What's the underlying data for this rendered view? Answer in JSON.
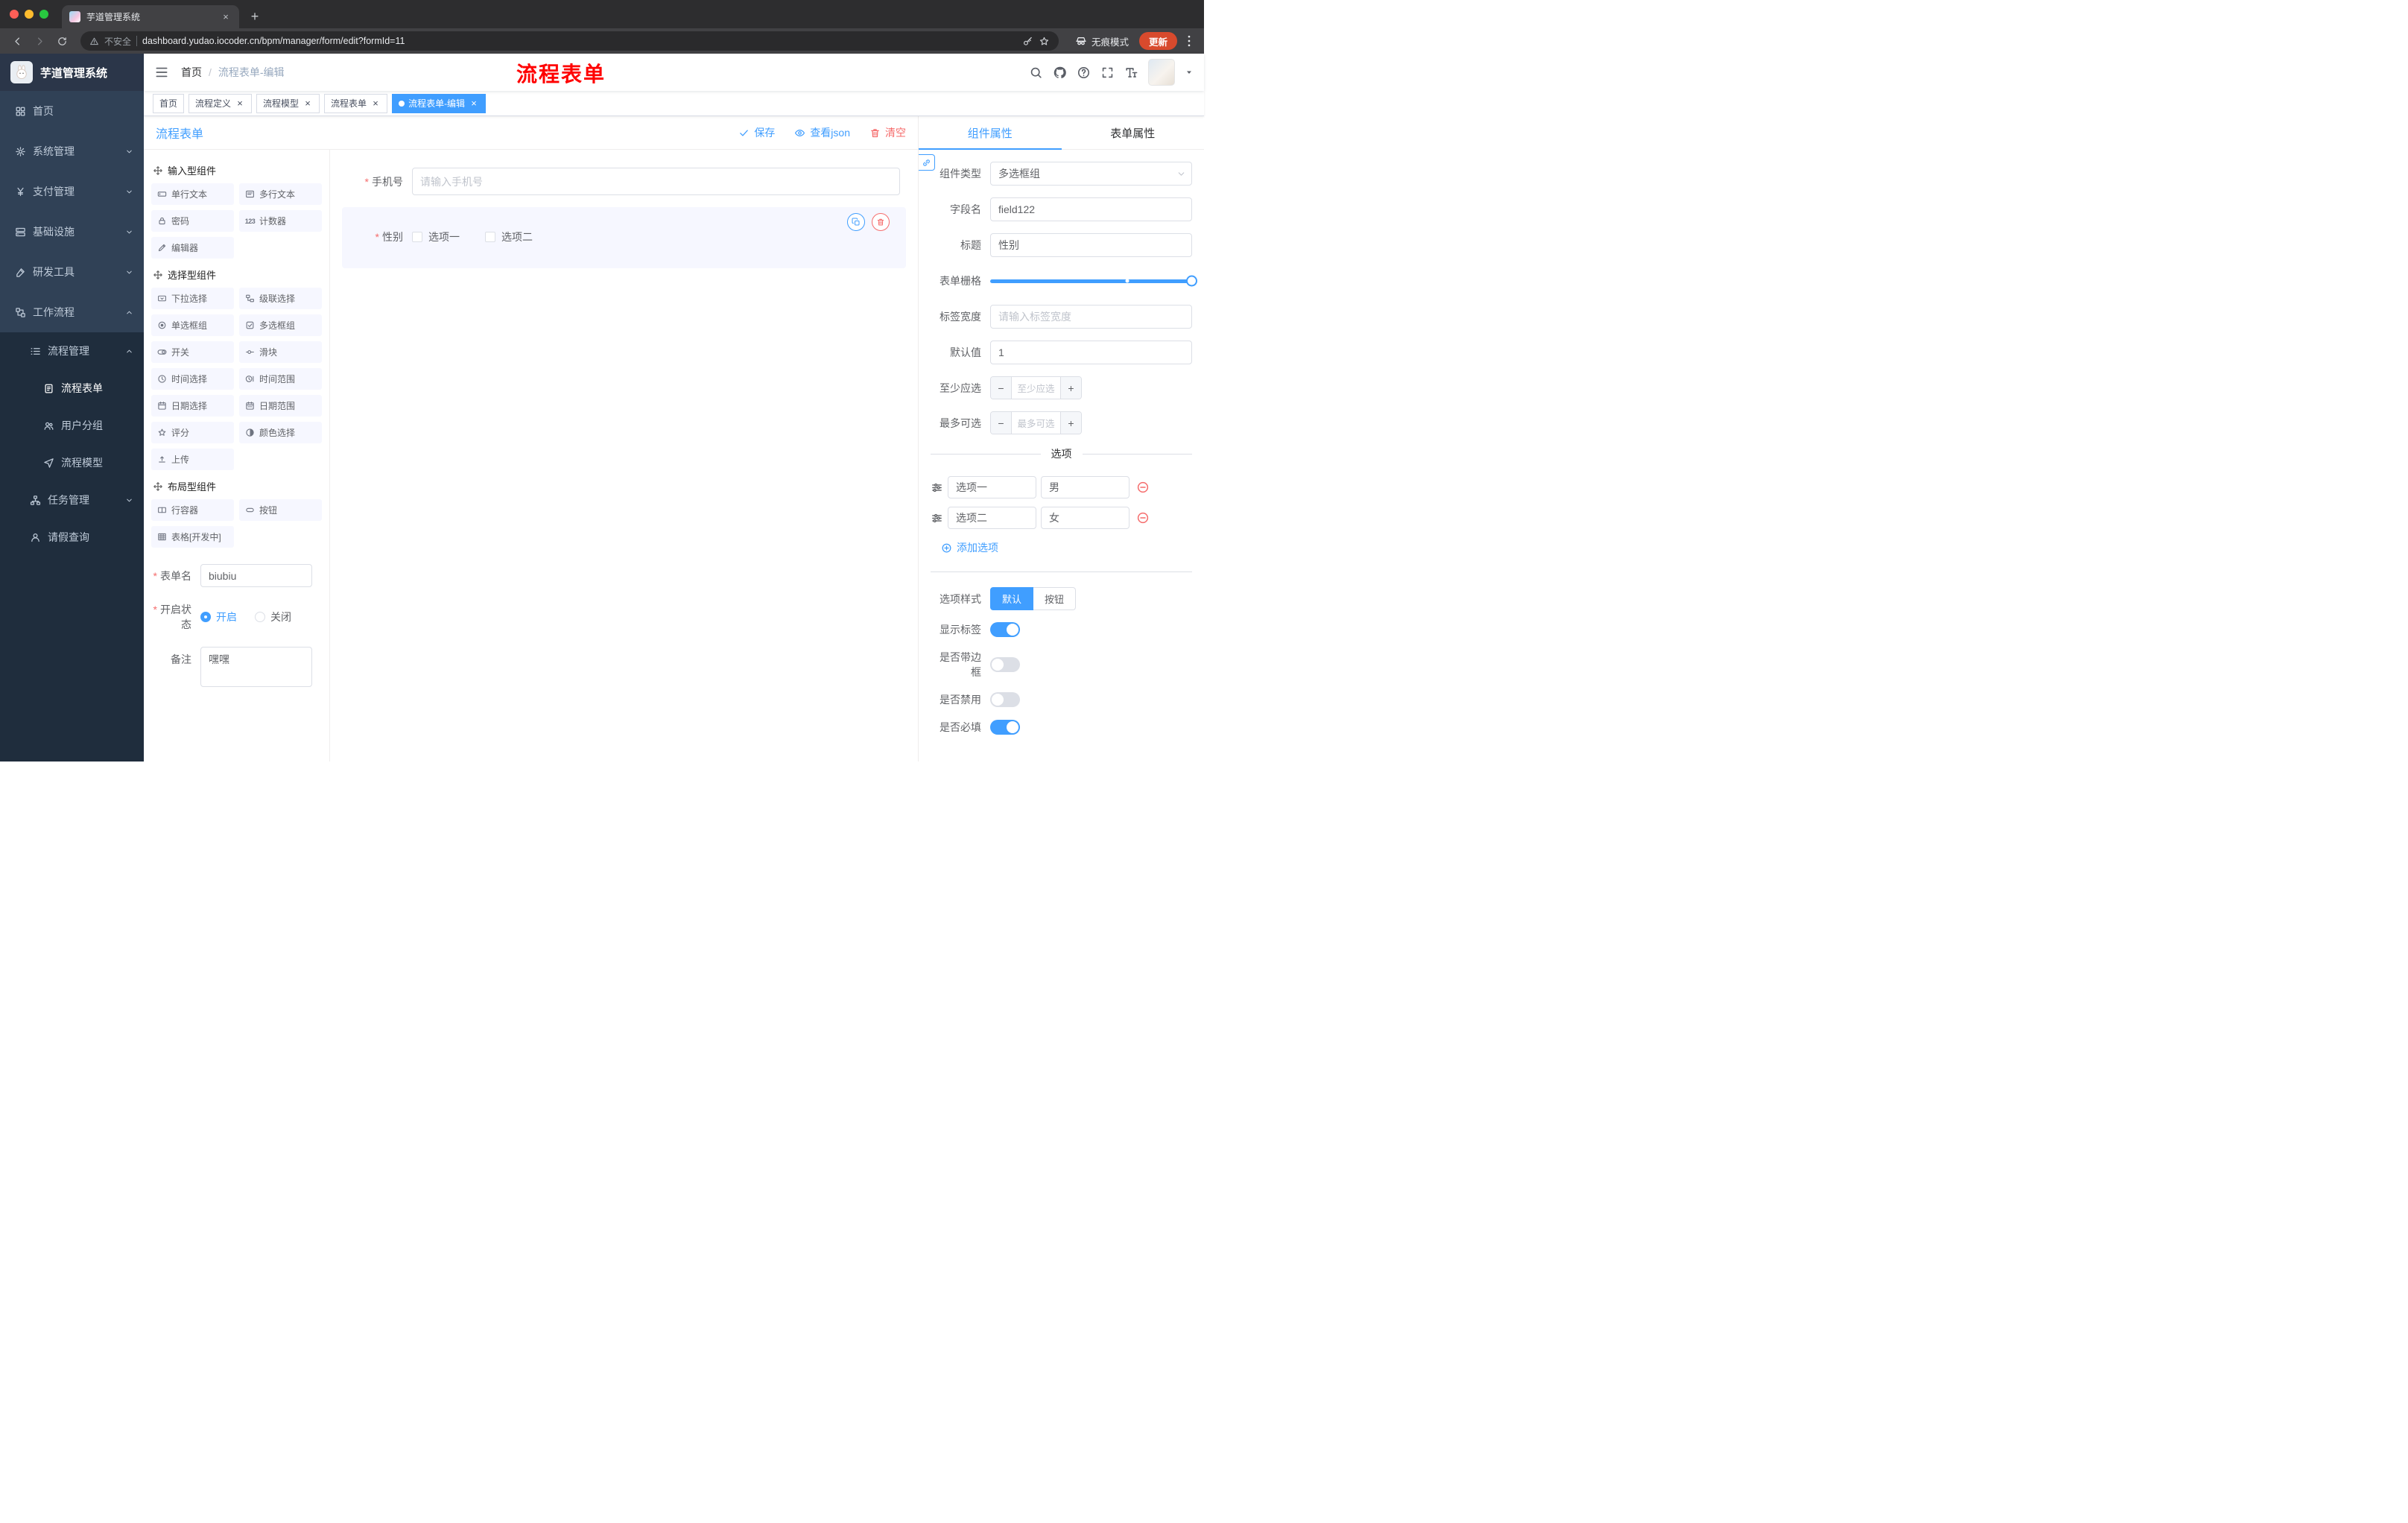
{
  "colors": {
    "accent": "#409eff",
    "danger": "#f56c6c",
    "sidebar_bg": "#304156",
    "sidebar_sub_bg": "#1f2d3d",
    "tag_active": "#409eff",
    "update_pill": "#d84a2d",
    "overlay_red": "#ff0000"
  },
  "browser": {
    "tab": {
      "title": "芋道管理系统"
    },
    "address": {
      "security_text": "不安全",
      "url": "dashboard.yudao.iocoder.cn/bpm/manager/form/edit?formId=11"
    },
    "incognito_label": "无痕模式",
    "update_label": "更新"
  },
  "sidebar": {
    "logo_title": "芋道管理系统",
    "items": [
      {
        "key": "home",
        "label": "首页",
        "icon": "dashboard",
        "level": 1
      },
      {
        "key": "system",
        "label": "系统管理",
        "icon": "gear",
        "level": 1,
        "chevron": "down"
      },
      {
        "key": "payment",
        "label": "支付管理",
        "icon": "yen",
        "level": 1,
        "chevron": "down"
      },
      {
        "key": "infra",
        "label": "基础设施",
        "icon": "infra",
        "level": 1,
        "chevron": "down"
      },
      {
        "key": "devtools",
        "label": "研发工具",
        "icon": "tools",
        "level": 1,
        "chevron": "down"
      },
      {
        "key": "workflow",
        "label": "工作流程",
        "icon": "workflow",
        "level": 1,
        "chevron": "up"
      },
      {
        "key": "process-manage",
        "label": "流程管理",
        "icon": "list",
        "level": 2,
        "chevron": "up"
      },
      {
        "key": "process-form",
        "label": "流程表单",
        "icon": "doc",
        "level": 3,
        "active": true
      },
      {
        "key": "user-group",
        "label": "用户分组",
        "icon": "users",
        "level": 3
      },
      {
        "key": "process-model",
        "label": "流程模型",
        "icon": "send",
        "level": 3
      },
      {
        "key": "task-manage",
        "label": "任务管理",
        "icon": "tree",
        "level": 2,
        "chevron": "down"
      },
      {
        "key": "leave-query",
        "label": "请假查询",
        "icon": "user",
        "level": 2
      }
    ]
  },
  "navbar": {
    "breadcrumb": [
      "首页",
      "流程表单-编辑"
    ],
    "overlay_title": "流程表单"
  },
  "tags_view": {
    "tabs": [
      {
        "label": "首页",
        "closable": false,
        "active": false
      },
      {
        "label": "流程定义",
        "closable": true,
        "active": false
      },
      {
        "label": "流程模型",
        "closable": true,
        "active": false
      },
      {
        "label": "流程表单",
        "closable": true,
        "active": false
      },
      {
        "label": "流程表单-编辑",
        "closable": true,
        "active": true
      }
    ]
  },
  "designer": {
    "title": "流程表单",
    "actions": {
      "save": "保存",
      "view_json": "查看json",
      "clear": "清空"
    },
    "groups": [
      {
        "title": "输入型组件",
        "items": [
          {
            "label": "单行文本",
            "icon": "input-field"
          },
          {
            "label": "多行文本",
            "icon": "textarea-field"
          },
          {
            "label": "密码",
            "icon": "lock"
          },
          {
            "label": "计数器",
            "icon": "counter"
          },
          {
            "label": "编辑器",
            "icon": "editor"
          }
        ]
      },
      {
        "title": "选择型组件",
        "items": [
          {
            "label": "下拉选择",
            "icon": "select"
          },
          {
            "label": "级联选择",
            "icon": "cascader"
          },
          {
            "label": "单选框组",
            "icon": "radio-comp"
          },
          {
            "label": "多选框组",
            "icon": "checkbox-comp"
          },
          {
            "label": "开关",
            "icon": "switch-comp"
          },
          {
            "label": "滑块",
            "icon": "slider-comp"
          },
          {
            "label": "时间选择",
            "icon": "time"
          },
          {
            "label": "时间范围",
            "icon": "time-range"
          },
          {
            "label": "日期选择",
            "icon": "calendar"
          },
          {
            "label": "日期范围",
            "icon": "calendar-range"
          },
          {
            "label": "评分",
            "icon": "star"
          },
          {
            "label": "颜色选择",
            "icon": "color"
          },
          {
            "label": "上传",
            "icon": "upload"
          }
        ]
      },
      {
        "title": "布局型组件",
        "items": [
          {
            "label": "行容器",
            "icon": "row"
          },
          {
            "label": "按钮",
            "icon": "button"
          },
          {
            "label": "表格[开发中]",
            "icon": "table"
          }
        ]
      }
    ],
    "meta_form": {
      "name_label": "表单名",
      "name_value": "biubiu",
      "status_label": "开启状态",
      "status_on": "开启",
      "status_off": "关闭",
      "remark_label": "备注",
      "remark_value": "嘿嘿"
    },
    "canvas": {
      "phone": {
        "label": "手机号",
        "placeholder": "请输入手机号"
      },
      "gender": {
        "label": "性别",
        "options": [
          "选项一",
          "选项二"
        ]
      }
    }
  },
  "props": {
    "tabs": {
      "component": "组件属性",
      "form": "表单属性"
    },
    "rows": {
      "type_label": "组件类型",
      "type_value": "多选框组",
      "field_label": "字段名",
      "field_value": "field122",
      "title_label": "标题",
      "title_value": "性别",
      "grid_label": "表单栅格",
      "width_label": "标签宽度",
      "width_placeholder": "请输入标签宽度",
      "default_label": "默认值",
      "default_value": "1",
      "min_label": "至少应选",
      "min_placeholder": "至少应选",
      "max_label": "最多可选",
      "max_placeholder": "最多可选"
    },
    "options": {
      "divider": "选项",
      "rows": [
        {
          "label": "选项一",
          "value": "男"
        },
        {
          "label": "选项二",
          "value": "女"
        }
      ],
      "add": "添加选项"
    },
    "style": {
      "label": "选项样式",
      "choices": [
        "默认",
        "按钮"
      ],
      "selected": "默认"
    },
    "switches": [
      {
        "key": "show-label",
        "label": "显示标签",
        "on": true
      },
      {
        "key": "border",
        "label": "是否带边框",
        "on": false
      },
      {
        "key": "disabled",
        "label": "是否禁用",
        "on": false
      },
      {
        "key": "required",
        "label": "是否必填",
        "on": true
      }
    ]
  }
}
